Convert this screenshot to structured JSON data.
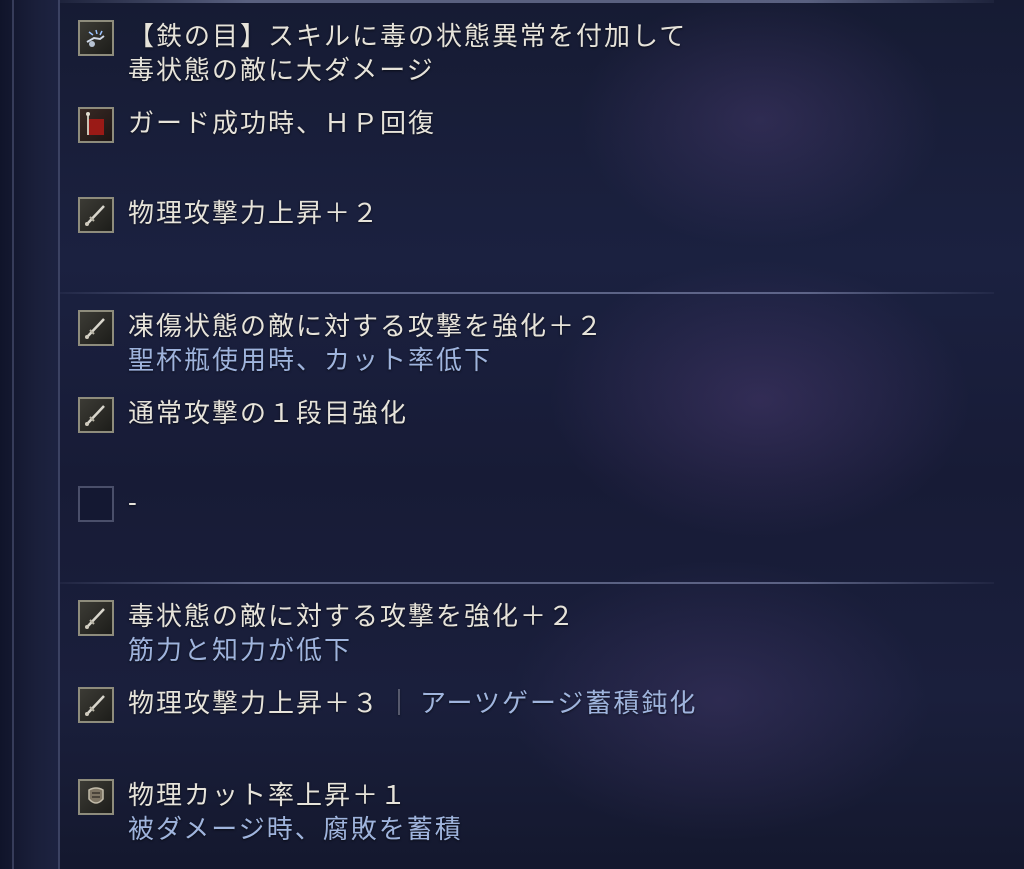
{
  "sections": [
    {
      "effects": [
        {
          "icon": "magic-hand-icon",
          "lines": [
            "【鉄の目】スキルに毒の状態異常を付加して",
            "毒状態の敵に大ダメージ"
          ]
        },
        {
          "icon": "red-banner-icon",
          "lines": [
            "ガード成功時、ＨＰ回復"
          ]
        },
        {
          "icon": "sword-icon",
          "lines": [
            "物理攻撃力上昇＋２"
          ]
        }
      ]
    },
    {
      "effects": [
        {
          "icon": "sword-icon",
          "main": "凍傷状態の敵に対する攻撃を強化＋２",
          "sub": "聖杯瓶使用時、カット率低下"
        },
        {
          "icon": "sword-icon",
          "main": "通常攻撃の１段目強化"
        },
        {
          "icon": "empty-slot-icon",
          "main": "-"
        }
      ]
    },
    {
      "effects": [
        {
          "icon": "sword-icon",
          "main": "毒状態の敵に対する攻撃を強化＋２",
          "sub": "筋力と知力が低下"
        },
        {
          "icon": "sword-icon",
          "main": "物理攻撃力上昇＋３",
          "separator": "｜",
          "secondary": "アーツゲージ蓄積鈍化"
        },
        {
          "icon": "armor-icon",
          "main": "物理カット率上昇＋１",
          "sub": "被ダメージ時、腐敗を蓄積"
        }
      ]
    }
  ],
  "colors": {
    "main_text": "#e6e3da",
    "sub_text": "#9fb4dd",
    "background": "#1b2140",
    "icon_border": "#8e8c7c"
  }
}
